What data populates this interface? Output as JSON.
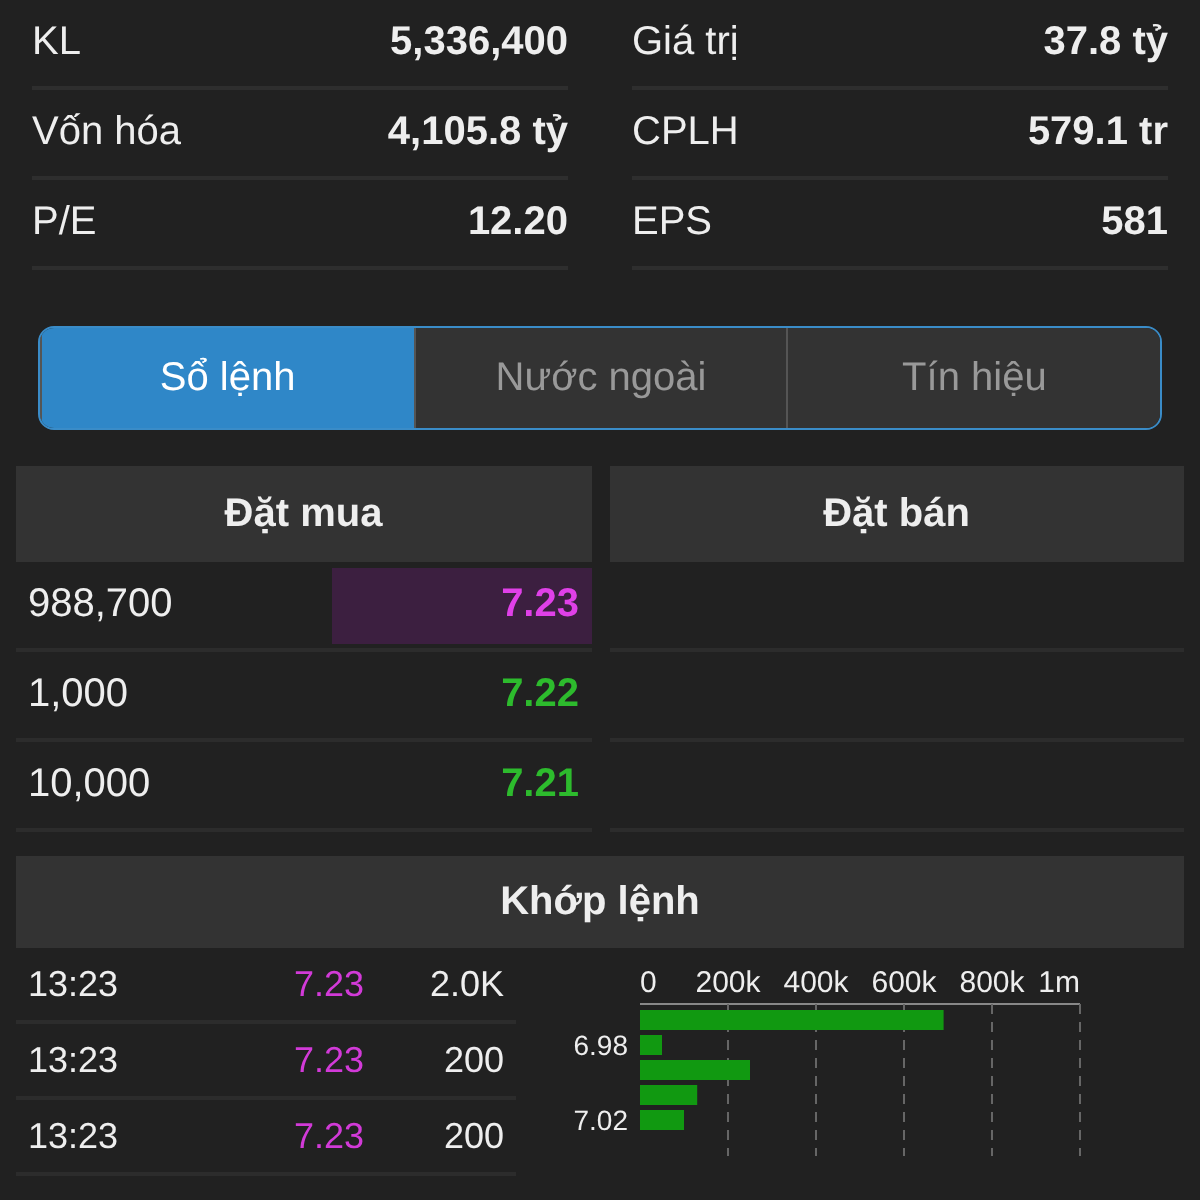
{
  "stats": [
    {
      "label": "KL",
      "value": "5,336,400"
    },
    {
      "label": "Giá trị",
      "value": "37.8 tỷ"
    },
    {
      "label": "Vốn hóa",
      "value": "4,105.8 tỷ"
    },
    {
      "label": "CPLH",
      "value": "579.1 tr"
    },
    {
      "label": "P/E",
      "value": "12.20"
    },
    {
      "label": "EPS",
      "value": "581"
    }
  ],
  "tabs": [
    {
      "label": "Sổ lệnh",
      "selected": true
    },
    {
      "label": "Nước ngoài",
      "selected": false
    },
    {
      "label": "Tín hiệu",
      "selected": false
    }
  ],
  "order_book": {
    "buy_title": "Đặt mua",
    "sell_title": "Đặt bán",
    "buy_rows": [
      {
        "volume": "988,700",
        "price": "7.23",
        "color": "#e040e8",
        "highlighted": true
      },
      {
        "volume": "1,000",
        "price": "7.22",
        "color": "#2dbb2d",
        "highlighted": false
      },
      {
        "volume": "10,000",
        "price": "7.21",
        "color": "#2dbb2d",
        "highlighted": false
      }
    ]
  },
  "matched": {
    "title": "Khớp lệnh",
    "trades": [
      {
        "time": "13:23",
        "price": "7.23",
        "color": "#d23ad8",
        "volume": "2.0K"
      },
      {
        "time": "13:23",
        "price": "7.23",
        "color": "#d23ad8",
        "volume": "200"
      },
      {
        "time": "13:23",
        "price": "7.23",
        "color": "#d23ad8",
        "volume": "200"
      }
    ],
    "chart_data": {
      "type": "bar",
      "orientation": "horizontal",
      "categories": [
        null,
        "6.98",
        null,
        null,
        "7.02"
      ],
      "grid": true,
      "series": [
        {
          "color": "#119911",
          "values": [
            690000,
            50000,
            250000,
            130000,
            100000
          ]
        }
      ],
      "xlim": [
        0,
        1000000
      ],
      "xticks": [
        {
          "value": 0,
          "label": "0"
        },
        {
          "value": 200000,
          "label": "200k"
        },
        {
          "value": 400000,
          "label": "400k"
        },
        {
          "value": 600000,
          "label": "600k"
        },
        {
          "value": 800000,
          "label": "800k"
        },
        {
          "value": 1000000,
          "label": "1m"
        }
      ]
    }
  }
}
